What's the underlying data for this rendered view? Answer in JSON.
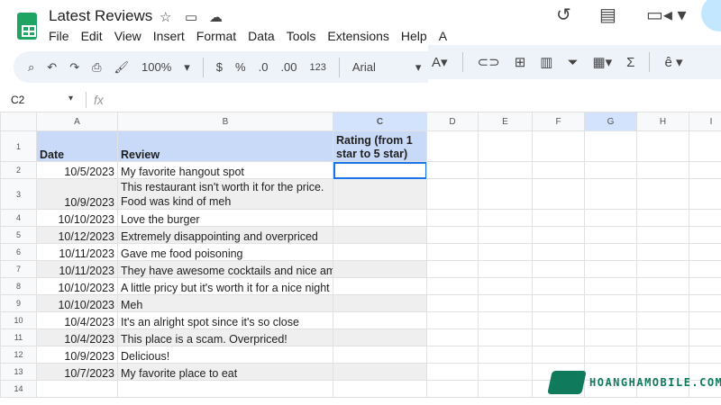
{
  "title": "Latest Reviews",
  "menu": [
    "File",
    "Edit",
    "View",
    "Insert",
    "Format",
    "Data",
    "Tools",
    "Extensions",
    "Help",
    "A"
  ],
  "toolbar": {
    "zoom": "100%",
    "currency": "$",
    "percent": "%",
    "dec_decrease": ".0",
    "dec_increase": ".00",
    "number_format": "123",
    "font": "Arial"
  },
  "name_box": "C2",
  "fx": "fx",
  "columns": [
    "A",
    "B",
    "C",
    "D",
    "E",
    "F",
    "G",
    "H",
    "I"
  ],
  "header_row": {
    "num": "1",
    "date": "Date",
    "review": "Review",
    "rating": "Rating (from 1 star to 5 star)"
  },
  "rows": [
    {
      "num": "2",
      "date": "10/5/2023",
      "review": "My favorite hangout spot"
    },
    {
      "num": "3",
      "date": "10/9/2023",
      "review": "This restaurant isn't worth it for the price. Food was kind of meh"
    },
    {
      "num": "4",
      "date": "10/10/2023",
      "review": "Love the burger"
    },
    {
      "num": "5",
      "date": "10/12/2023",
      "review": "Extremely disappointing and overpriced"
    },
    {
      "num": "6",
      "date": "10/11/2023",
      "review": "Gave me food poisoning"
    },
    {
      "num": "7",
      "date": "10/11/2023",
      "review": "They have awesome cocktails and nice ambience"
    },
    {
      "num": "8",
      "date": "10/10/2023",
      "review": "A little pricy but it's worth it for a nice night"
    },
    {
      "num": "9",
      "date": "10/10/2023",
      "review": "Meh"
    },
    {
      "num": "10",
      "date": "10/4/2023",
      "review": "It's an alright spot since it's so close"
    },
    {
      "num": "11",
      "date": "10/4/2023",
      "review": "This place is a scam. Overpriced!"
    },
    {
      "num": "12",
      "date": "10/9/2023",
      "review": "Delicious!"
    },
    {
      "num": "13",
      "date": "10/7/2023",
      "review": "My favorite place to eat"
    },
    {
      "num": "14",
      "date": "",
      "review": ""
    }
  ],
  "watermark": {
    "text": "HOANGHAMOBILE.COM",
    "color": "#0f7a5c"
  },
  "accent": "#1a73e8"
}
